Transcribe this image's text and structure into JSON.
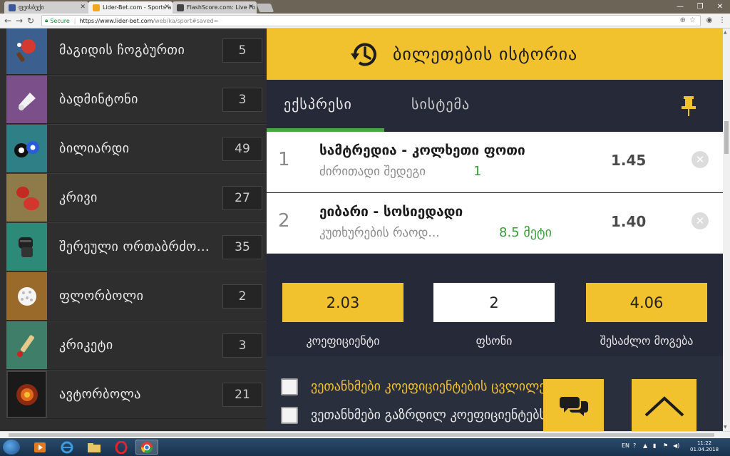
{
  "browser": {
    "tabs": [
      {
        "label": "ფეისბუქი",
        "icon": "facebook-icon"
      },
      {
        "label": "Lider-Bet.com - Sports a",
        "icon": "liderbet-icon"
      },
      {
        "label": "FlashScore.com: Live Fo",
        "icon": "flashscore-icon"
      }
    ],
    "secure_label": "Secure",
    "url_host": "https://www.lider-bet.com",
    "url_path": "/web/ka/sport#saved="
  },
  "sports": [
    {
      "name": "მაგიდის ჩოგბურთი",
      "count": "5",
      "icon": "table-tennis-icon",
      "bg": "#3b5f8f"
    },
    {
      "name": "ბადმინტონი",
      "count": "3",
      "icon": "badminton-icon",
      "bg": "#7a4f8a"
    },
    {
      "name": "ბილიარდი",
      "count": "49",
      "icon": "billiards-icon",
      "bg": "#2f7f86"
    },
    {
      "name": "კრივი",
      "count": "27",
      "icon": "boxing-icon",
      "bg": "#8f7a4a"
    },
    {
      "name": "შერეული ორთაბრძოლები",
      "count": "35",
      "icon": "mma-glove-icon",
      "bg": "#2e8a78"
    },
    {
      "name": "ფლორბოლი",
      "count": "2",
      "icon": "floorball-icon",
      "bg": "#9a6a2a"
    },
    {
      "name": "კრიკეტი",
      "count": "3",
      "icon": "cricket-icon",
      "bg": "#3f7f6a"
    },
    {
      "name": "ავტორბოლა",
      "count": "21",
      "icon": "motorsport-icon",
      "bg": "#1a1a1a"
    }
  ],
  "ticket": {
    "title": "ბილეთების ისტორია",
    "tab_express": "ექსპრესი",
    "tab_system": "სისტემა",
    "bets": [
      {
        "index": "1",
        "match": "სამტრედია - კოლხეთი ფოთი",
        "market": "ძირითადი შედეგი",
        "pick": "1",
        "odd": "1.45"
      },
      {
        "index": "2",
        "match": "ეიბარი - სოსიედადი",
        "market": "კუთხურების რაოდ...",
        "pick": "8.5 მეტი",
        "odd": "1.40"
      }
    ],
    "total_odds": "2.03",
    "stake": "2",
    "potential_win": "4.06",
    "label_odds": "კოეფიციენტი",
    "label_stake": "ფსონი",
    "label_win": "შესაძლო მოგება",
    "agree_odds": "ვეთანხმები კოეფიციენტების ცვლილებას",
    "agree_increase": "ვეთანხმები გაზრდილ კოეფიციენტებს"
  },
  "taskbar": {
    "lang": "EN",
    "time": "11:22",
    "date": "01.04.2018"
  },
  "colors": {
    "accent_yellow": "#f2c12e",
    "panel_bg": "#262a38",
    "green": "#47a843"
  }
}
